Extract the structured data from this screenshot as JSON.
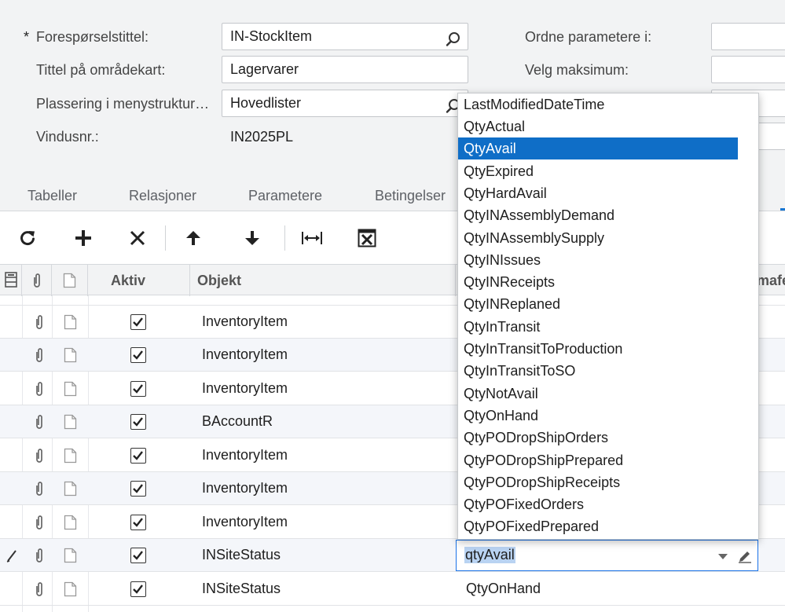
{
  "form": {
    "required_mark": "*",
    "inquiry_title_label": "Forespørselstittel:",
    "inquiry_title_value": "IN-StockItem",
    "sitemap_title_label": "Tittel på områdekart:",
    "sitemap_title_value": "Lagervarer",
    "menu_location_label": "Plassering i menystruktur…",
    "menu_location_value": "Hovedlister",
    "screen_id_label": "Vindusnr.:",
    "screen_id_value": "IN2025PL",
    "arrange_params_label": "Ordne parametere i:",
    "select_top_label": "Velg maksimum:"
  },
  "tabs": [
    {
      "label": "Tabeller"
    },
    {
      "label": "Relasjoner"
    },
    {
      "label": "Parametere"
    },
    {
      "label": "Betingelser"
    }
  ],
  "toolbar": {
    "refresh": "refresh-icon",
    "add": "plus-icon",
    "delete": "close-icon",
    "move_up": "arrow-up-icon",
    "move_down": "arrow-down-icon",
    "fit_width": "fit-width-icon",
    "export": "export-excel-icon"
  },
  "grid": {
    "headers": {
      "active": "Aktiv",
      "object": "Objekt",
      "schema_fragment": "mafe"
    },
    "rows": [
      {
        "active": true,
        "object": "InventoryItem",
        "field": ""
      },
      {
        "active": true,
        "object": "InventoryItem",
        "field": ""
      },
      {
        "active": true,
        "object": "InventoryItem",
        "field": ""
      },
      {
        "active": true,
        "object": "BAccountR",
        "field": ""
      },
      {
        "active": true,
        "object": "InventoryItem",
        "field": ""
      },
      {
        "active": true,
        "object": "InventoryItem",
        "field": ""
      },
      {
        "active": true,
        "object": "InventoryItem",
        "field": ""
      },
      {
        "active": true,
        "object": "INSiteStatus",
        "field": "qtyAvail",
        "editing": true
      },
      {
        "active": true,
        "object": "INSiteStatus",
        "field": "QtyOnHand"
      }
    ]
  },
  "dropdown": {
    "selected": "QtyAvail",
    "options": [
      "LastModifiedDateTime",
      "QtyActual",
      "QtyAvail",
      "QtyExpired",
      "QtyHardAvail",
      "QtyINAssemblyDemand",
      "QtyINAssemblySupply",
      "QtyINIssues",
      "QtyINReceipts",
      "QtyINReplaned",
      "QtyInTransit",
      "QtyInTransitToProduction",
      "QtyInTransitToSO",
      "QtyNotAvail",
      "QtyOnHand",
      "QtyPODropShipOrders",
      "QtyPODropShipPrepared",
      "QtyPODropShipReceipts",
      "QtyPOFixedOrders",
      "QtyPOFixedPrepared"
    ]
  },
  "colors": {
    "accent": "#0f6ec7",
    "editor_border": "#1a73e8",
    "selection": "#b9d3f2"
  }
}
